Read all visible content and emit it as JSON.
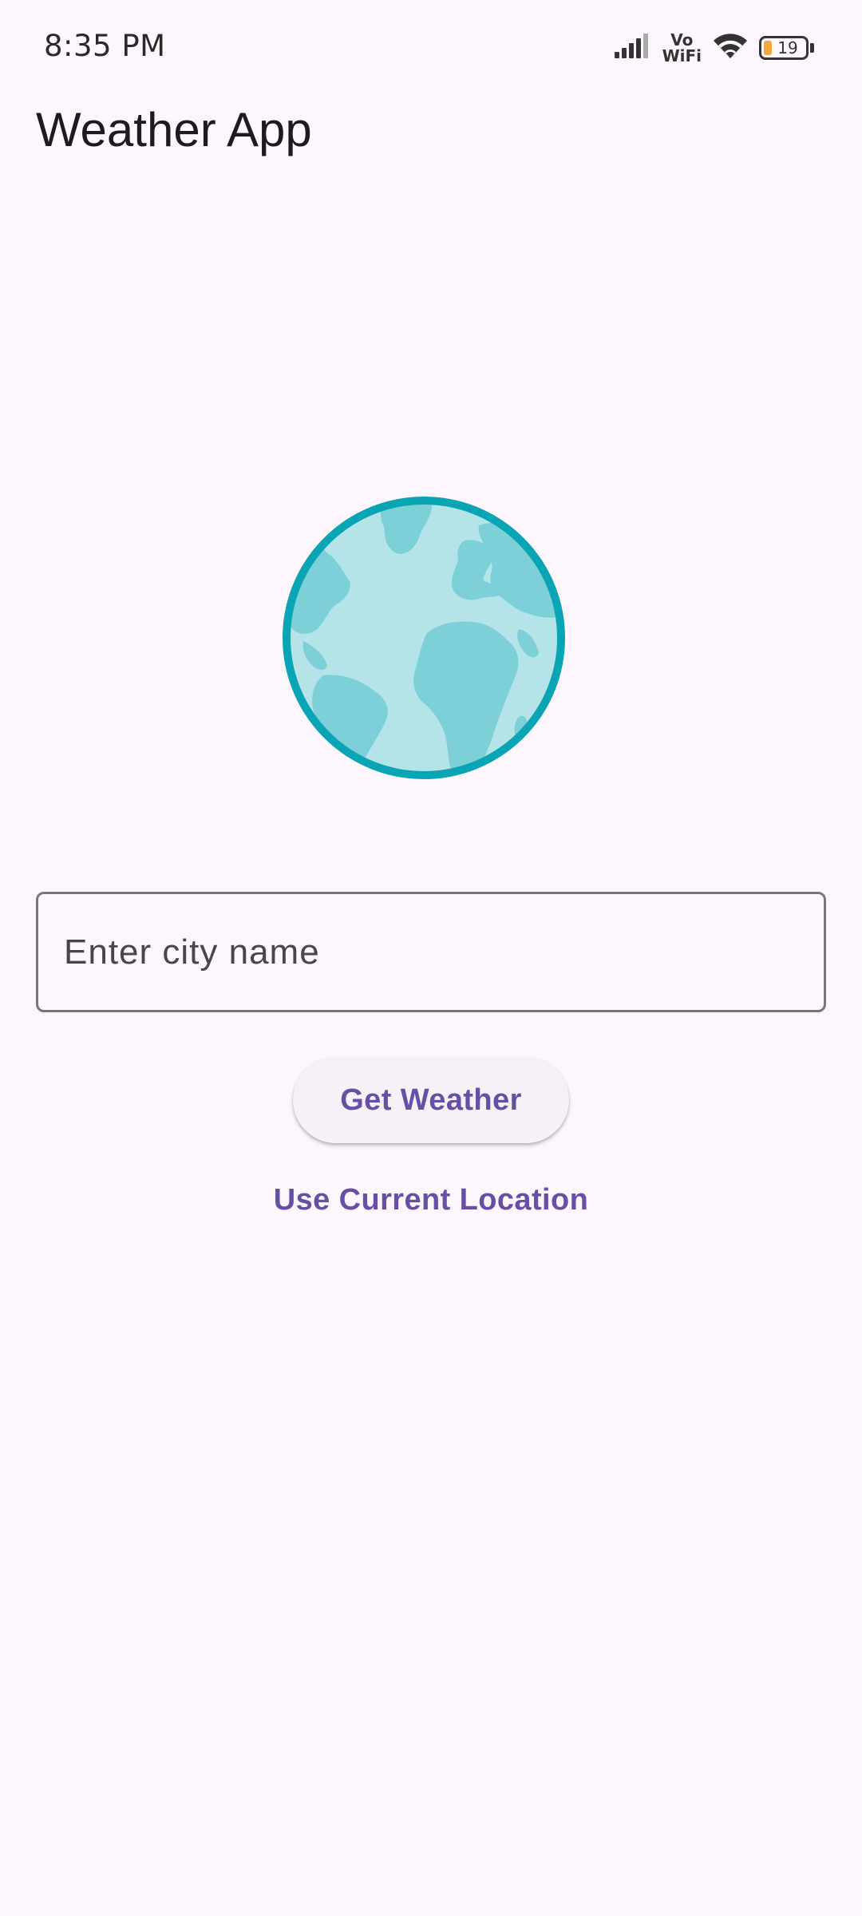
{
  "status_bar": {
    "time": "8:35 PM",
    "vowifi_top": "Vo",
    "vowifi_bottom": "WiFi",
    "battery_level": "19"
  },
  "app_bar": {
    "title": "Weather App"
  },
  "hero": {
    "icon": "globe-icon"
  },
  "search": {
    "placeholder": "Enter city name",
    "value": ""
  },
  "actions": {
    "get_weather_label": "Get Weather",
    "use_location_label": "Use Current Location"
  },
  "colors": {
    "background": "#fdf7fd",
    "primary": "#6750a4",
    "globe_ring": "#0aa5b4",
    "globe_ocean": "#b4e4e8",
    "globe_land": "#7dd0d8"
  }
}
